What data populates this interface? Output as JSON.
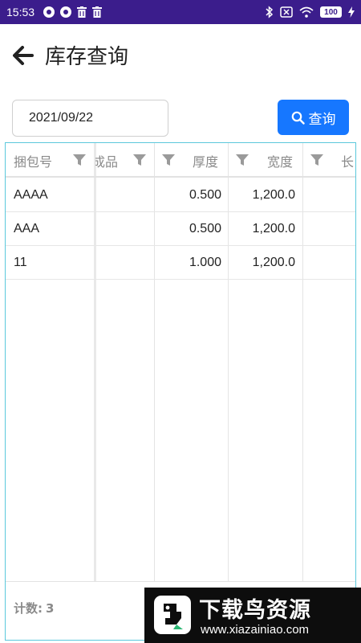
{
  "status_bar": {
    "time": "15:53",
    "battery": "100",
    "icons": [
      "record-icon",
      "record-icon",
      "trash-icon",
      "trash-icon",
      "bluetooth-icon",
      "no-sim-icon",
      "wifi-icon",
      "battery-icon",
      "charging-icon"
    ]
  },
  "header": {
    "title": "库存查询",
    "back_icon": "arrow-left-icon"
  },
  "search": {
    "date_value": "2021/09/22",
    "query_label": "查询",
    "query_icon": "search-icon"
  },
  "table": {
    "columns": [
      {
        "label": "捆包号",
        "filter_icon": "filter-icon"
      },
      {
        "label": "成品",
        "filter_icon": "filter-icon"
      },
      {
        "label": "厚度",
        "filter_icon": "filter-icon"
      },
      {
        "label": "宽度",
        "filter_icon": "filter-icon"
      },
      {
        "label": "长",
        "filter_icon": "filter-icon"
      }
    ],
    "rows": [
      {
        "bundle": "AAAA",
        "product": "",
        "thickness": "0.500",
        "width": "1,200.0",
        "length": ""
      },
      {
        "bundle": "AAA",
        "product": "",
        "thickness": "0.500",
        "width": "1,200.0",
        "length": ""
      },
      {
        "bundle": "11",
        "product": "",
        "thickness": "1.000",
        "width": "1,200.0",
        "length": ""
      }
    ],
    "footer": {
      "count_label": "计数:",
      "count_value": "3"
    }
  },
  "watermark": {
    "title": "下载鸟资源",
    "url": "www.xiazainiao.com"
  },
  "colors": {
    "status_bar": "#3b1d8c",
    "accent": "#1677ff",
    "grid_border": "#5bc8dc"
  }
}
